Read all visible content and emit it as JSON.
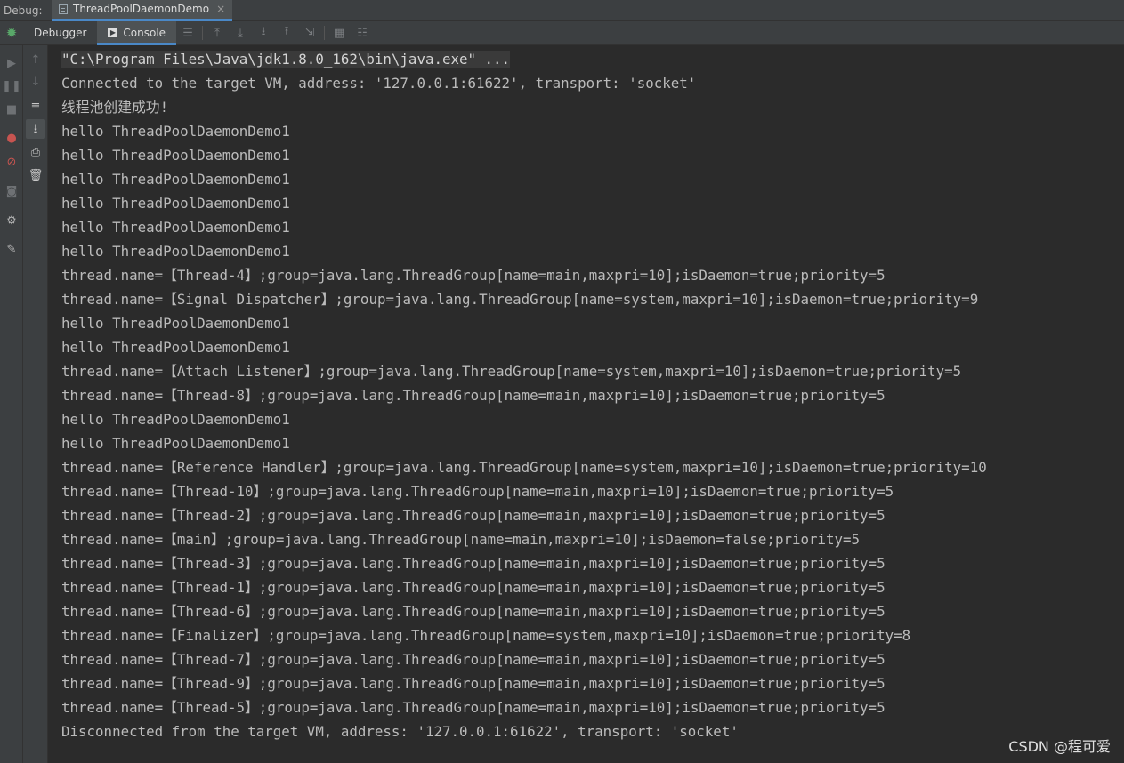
{
  "topbar": {
    "debug_label": "Debug:",
    "session_tab": "ThreadPoolDaemonDemo",
    "close": "×"
  },
  "toolbar": {
    "debugger_tab": "Debugger",
    "console_tab": "Console"
  },
  "console": {
    "lines": [
      "\"C:\\Program Files\\Java\\jdk1.8.0_162\\bin\\java.exe\" ...",
      "Connected to the target VM, address: '127.0.0.1:61622', transport: 'socket'",
      "线程池创建成功!",
      "hello ThreadPoolDaemonDemo1",
      "hello ThreadPoolDaemonDemo1",
      "hello ThreadPoolDaemonDemo1",
      "hello ThreadPoolDaemonDemo1",
      "hello ThreadPoolDaemonDemo1",
      "hello ThreadPoolDaemonDemo1",
      "thread.name=【Thread-4】;group=java.lang.ThreadGroup[name=main,maxpri=10];isDaemon=true;priority=5",
      "thread.name=【Signal Dispatcher】;group=java.lang.ThreadGroup[name=system,maxpri=10];isDaemon=true;priority=9",
      "hello ThreadPoolDaemonDemo1",
      "hello ThreadPoolDaemonDemo1",
      "thread.name=【Attach Listener】;group=java.lang.ThreadGroup[name=system,maxpri=10];isDaemon=true;priority=5",
      "thread.name=【Thread-8】;group=java.lang.ThreadGroup[name=main,maxpri=10];isDaemon=true;priority=5",
      "hello ThreadPoolDaemonDemo1",
      "hello ThreadPoolDaemonDemo1",
      "thread.name=【Reference Handler】;group=java.lang.ThreadGroup[name=system,maxpri=10];isDaemon=true;priority=10",
      "thread.name=【Thread-10】;group=java.lang.ThreadGroup[name=main,maxpri=10];isDaemon=true;priority=5",
      "thread.name=【Thread-2】;group=java.lang.ThreadGroup[name=main,maxpri=10];isDaemon=true;priority=5",
      "thread.name=【main】;group=java.lang.ThreadGroup[name=main,maxpri=10];isDaemon=false;priority=5",
      "thread.name=【Thread-3】;group=java.lang.ThreadGroup[name=main,maxpri=10];isDaemon=true;priority=5",
      "thread.name=【Thread-1】;group=java.lang.ThreadGroup[name=main,maxpri=10];isDaemon=true;priority=5",
      "thread.name=【Thread-6】;group=java.lang.ThreadGroup[name=main,maxpri=10];isDaemon=true;priority=5",
      "thread.name=【Finalizer】;group=java.lang.ThreadGroup[name=system,maxpri=10];isDaemon=true;priority=8",
      "thread.name=【Thread-7】;group=java.lang.ThreadGroup[name=main,maxpri=10];isDaemon=true;priority=5",
      "thread.name=【Thread-9】;group=java.lang.ThreadGroup[name=main,maxpri=10];isDaemon=true;priority=5",
      "thread.name=【Thread-5】;group=java.lang.ThreadGroup[name=main,maxpri=10];isDaemon=true;priority=5",
      "Disconnected from the target VM, address: '127.0.0.1:61622', transport: 'socket'"
    ]
  },
  "watermark": "CSDN @程可爱",
  "colors": {
    "background": "#2b2b2b",
    "panel": "#3c3f41",
    "text": "#bbbbbb",
    "accent": "#4a88c7",
    "bug_green": "#59a869",
    "stop_red": "#c75450"
  },
  "icons": {
    "left_strip": [
      "resume-icon",
      "pause-icon",
      "stop-icon",
      "view-breakpoints-icon",
      "mute-breakpoints-icon",
      "camera-icon",
      "settings-icon",
      "pin-icon"
    ],
    "console_strip": [
      "scroll-up-icon",
      "scroll-down-icon",
      "soft-wrap-icon",
      "scroll-to-end-icon",
      "print-icon",
      "clear-all-icon"
    ]
  }
}
